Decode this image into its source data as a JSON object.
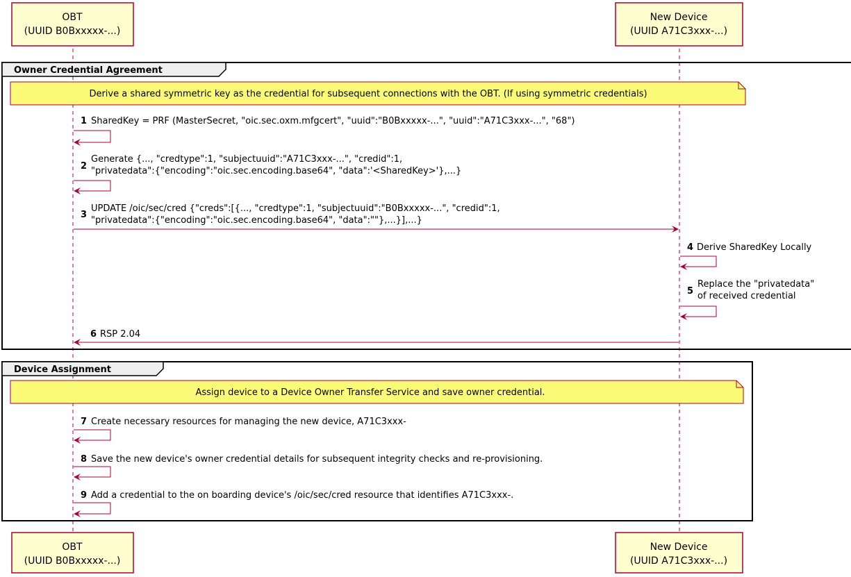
{
  "participants": [
    {
      "name": "OBT",
      "uuid": "(UUID B0Bxxxxx-...)"
    },
    {
      "name": "New Device",
      "uuid": "(UUID A71C3xxx-...)"
    }
  ],
  "groups": [
    {
      "title": "Owner Credential Agreement",
      "note": "Derive a shared symmetric key as the credential for subsequent connections with the OBT. (If using symmetric credentials)"
    },
    {
      "title": "Device Assignment",
      "note": "Assign device to a Device Owner Transfer Service and save owner credential."
    }
  ],
  "messages": [
    {
      "num": "1",
      "lines": [
        "SharedKey = PRF (MasterSecret, \"oic.sec.oxm.mfgcert\", \"uuid\":\"B0Bxxxxx-...\", \"uuid\":\"A71C3xxx-...\", \"68\")"
      ]
    },
    {
      "num": "2",
      "lines": [
        "Generate {..., \"credtype\":1, \"subjectuuid\":\"A71C3xxx-...\", \"credid\":1,",
        " \"privatedata\":{\"encoding\":\"oic.sec.encoding.base64\", \"data\":'<SharedKey>'},...}"
      ]
    },
    {
      "num": "3",
      "lines": [
        "UPDATE /oic/sec/cred {\"creds\":[{..., \"credtype\":1, \"subjectuuid\":\"B0Bxxxxx-...\", \"credid\":1,",
        " \"privatedata\":{\"encoding\":\"oic.sec.encoding.base64\", \"data\":\"\"},...}],...}"
      ]
    },
    {
      "num": "4",
      "lines": [
        "Derive SharedKey Locally"
      ]
    },
    {
      "num": "5",
      "lines": [
        "Replace the \"privatedata\"",
        "of received credential"
      ]
    },
    {
      "num": "6",
      "lines": [
        "RSP 2.04"
      ]
    },
    {
      "num": "7",
      "lines": [
        "Create necessary resources for managing the new device, A71C3xxx-"
      ]
    },
    {
      "num": "8",
      "lines": [
        "Save the new device's owner credential details for subsequent integrity checks and re-provisioning."
      ]
    },
    {
      "num": "9",
      "lines": [
        "Add a credential to the on boarding device's /oic/sec/cred resource that identifies A71C3xxx-."
      ]
    }
  ],
  "colors": {
    "participant_fill": "#FEFECE",
    "participant_border": "#A80036",
    "arrow": "#A80036",
    "note_fill": "#FBFB77",
    "lifeline": "#A80036"
  }
}
